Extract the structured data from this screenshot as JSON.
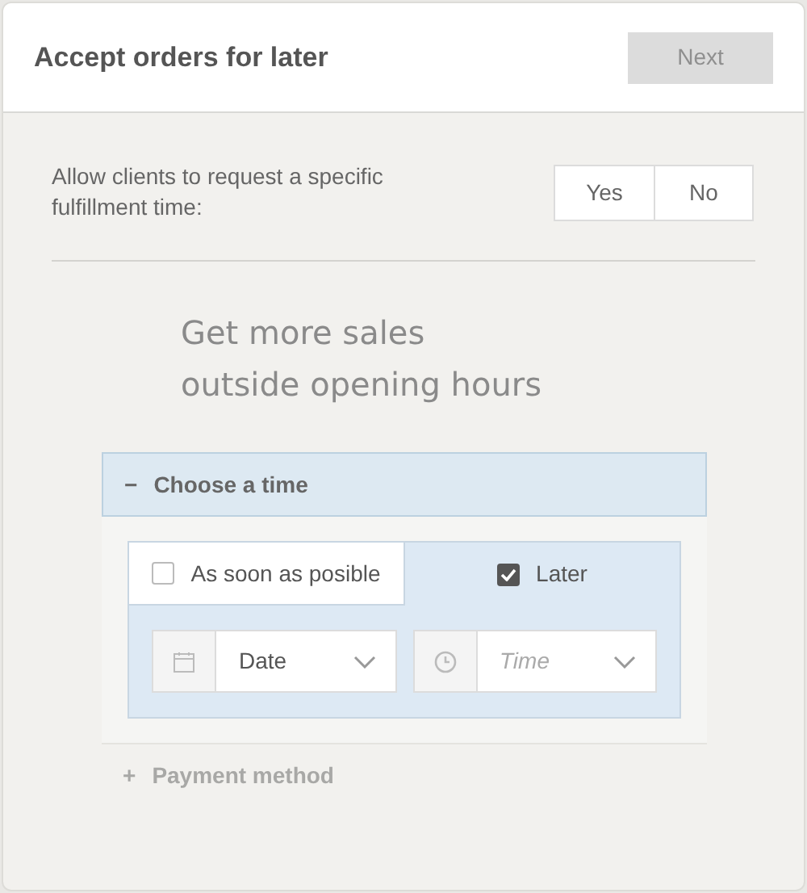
{
  "header": {
    "title": "Accept orders for later",
    "next_button": {
      "label": "Next",
      "disabled": true
    }
  },
  "question": {
    "label": "Allow clients to request a specific fulfillment time:",
    "options": [
      {
        "label": "Yes",
        "selected": false
      },
      {
        "label": "No",
        "selected": false
      }
    ]
  },
  "tagline": [
    "Get more sales",
    "outside opening hours"
  ],
  "sections": [
    {
      "toggle": "−",
      "title": "Choose a time",
      "expanded": true,
      "choices": [
        {
          "label": "As soon as posible",
          "checked": false
        },
        {
          "label": "Later",
          "checked": true
        }
      ],
      "fields": [
        {
          "kind": "date",
          "value": "Date"
        },
        {
          "kind": "time",
          "placeholder": "Time"
        }
      ]
    },
    {
      "toggle": "+",
      "title": "Payment method",
      "expanded": false
    }
  ]
}
